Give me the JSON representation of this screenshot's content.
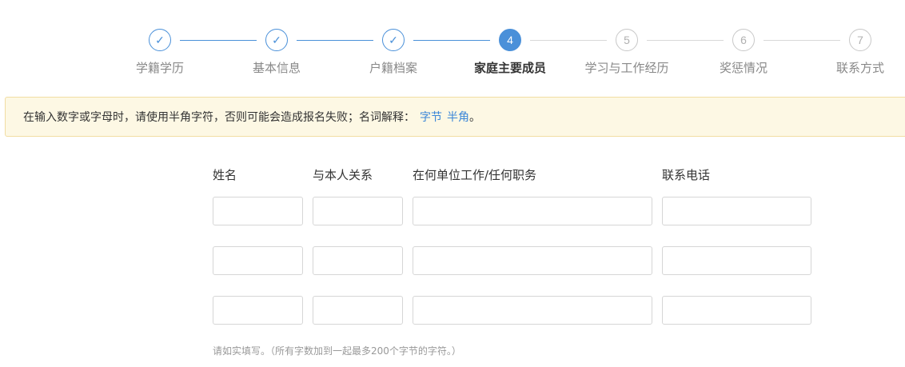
{
  "steps": [
    {
      "index": "1",
      "label": "学籍学历",
      "status": "done"
    },
    {
      "index": "2",
      "label": "基本信息",
      "status": "done"
    },
    {
      "index": "3",
      "label": "户籍档案",
      "status": "done"
    },
    {
      "index": "4",
      "label": "家庭主要成员",
      "status": "active"
    },
    {
      "index": "5",
      "label": "学习与工作经历",
      "status": "todo"
    },
    {
      "index": "6",
      "label": "奖惩情况",
      "status": "todo"
    },
    {
      "index": "7",
      "label": "联系方式",
      "status": "todo"
    }
  ],
  "check_icon": "✓",
  "notice": {
    "text": "在输入数字或字母时，请使用半角字符，否则可能会造成报名失败；名词解释：",
    "link1": "字节",
    "link2": "半角",
    "suffix": "。"
  },
  "table": {
    "headers": {
      "name": "姓名",
      "relation": "与本人关系",
      "workplace": "在何单位工作/任何职务",
      "phone": "联系电话"
    },
    "rows": [
      {
        "name": "",
        "relation": "",
        "workplace": "",
        "phone": ""
      },
      {
        "name": "",
        "relation": "",
        "workplace": "",
        "phone": ""
      },
      {
        "name": "",
        "relation": "",
        "workplace": "",
        "phone": ""
      }
    ]
  },
  "hint": "请如实填写。（所有字数加到一起最多200个字节的字符。）",
  "colors": {
    "accent": "#4a90d9",
    "notice_bg": "#fdf8e4",
    "notice_border": "#f1dda3",
    "link": "#3b86d8"
  }
}
